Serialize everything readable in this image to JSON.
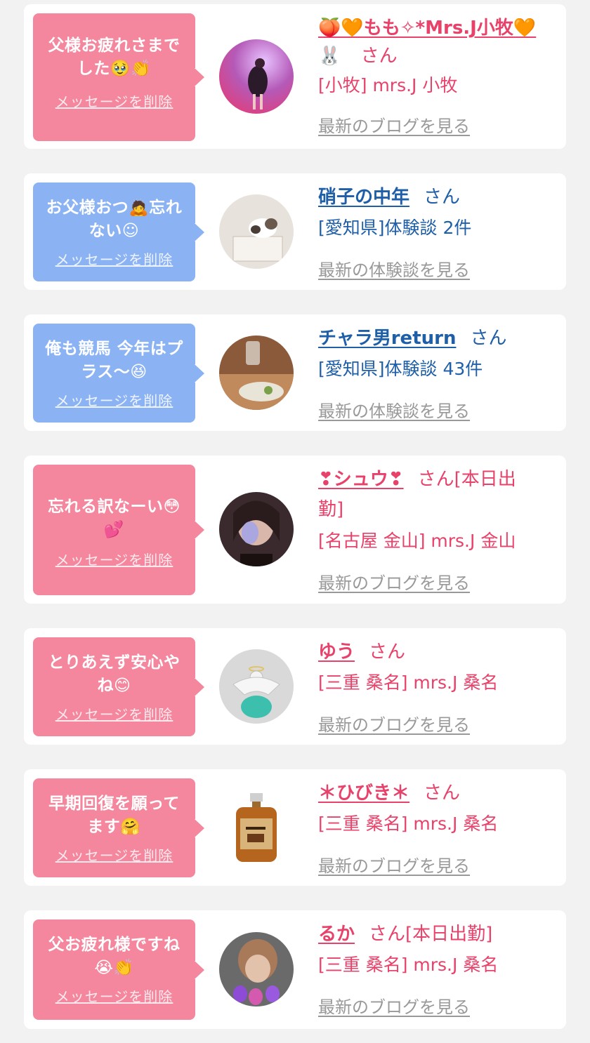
{
  "items": [
    {
      "message_lines": [
        "父様お疲れさまで",
        "した🥹👏"
      ],
      "delete_label": "メッセージを削除",
      "name": "🍑🧡もも✧*Mrs.J小牧🧡",
      "name_cont": "🐰",
      "san": "さん",
      "sub": "[小牧] mrs.J 小牧",
      "latest": "最新のブログを見る",
      "theme": "pink",
      "avatar_icon": "dancer-photo"
    },
    {
      "message_lines": [
        "お父様おつ🙇忘れ",
        "ない☺"
      ],
      "delete_label": "メッセージを削除",
      "name": "硝子の中年",
      "san": "さん",
      "sub": "[愛知県]体験談 2件",
      "latest": "最新の体験談を見る",
      "theme": "blue",
      "avatar_icon": "cat-photo"
    },
    {
      "message_lines": [
        "俺も競馬 今年はプ",
        "ラス〜😆"
      ],
      "delete_label": "メッセージを削除",
      "name": "チャラ男return",
      "san": "さん",
      "sub": "[愛知県]体験談 43件",
      "latest": "最新の体験談を見る",
      "theme": "blue",
      "avatar_icon": "food-photo"
    },
    {
      "message_lines": [
        "忘れる訳なーい😳",
        "💕"
      ],
      "delete_label": "メッセージを削除",
      "name": "❣シュウ❣",
      "san": "さん[本日出",
      "name_cont": "勤]",
      "sub": "[名古屋 金山] mrs.J 金山",
      "latest": "最新のブログを見る",
      "theme": "pink",
      "avatar_icon": "woman-photo"
    },
    {
      "message_lines": [
        "とりあえず安心や",
        "ね😊"
      ],
      "delete_label": "メッセージを削除",
      "name": "ゆう",
      "san": "さん",
      "sub": "[三重 桑名] mrs.J 桑名",
      "latest": "最新のブログを見る",
      "theme": "pink",
      "avatar_icon": "angel-figurine-photo"
    },
    {
      "message_lines": [
        "早期回復を願って",
        "ます🤗"
      ],
      "delete_label": "メッセージを削除",
      "name": "＊ひびき＊",
      "san": "さん",
      "sub": "[三重 桑名] mrs.J 桑名",
      "latest": "最新のブログを見る",
      "theme": "pink",
      "avatar_icon": "whisky-bottle-photo"
    },
    {
      "message_lines": [
        "父お疲れ様ですね",
        "😭👏"
      ],
      "delete_label": "メッセージを削除",
      "name": "るか",
      "san": "さん[本日出勤]",
      "sub": "[三重 桑名] mrs.J 桑名",
      "latest": "最新のブログを見る",
      "theme": "pink",
      "avatar_icon": "woman-flowers-photo"
    }
  ],
  "colors": {
    "pink_text": "#e8426a",
    "blue_text": "#1f5fa8",
    "pink_bubble": "#f4879d",
    "blue_bubble": "#8bb3f4",
    "background": "#f2f2f2"
  }
}
